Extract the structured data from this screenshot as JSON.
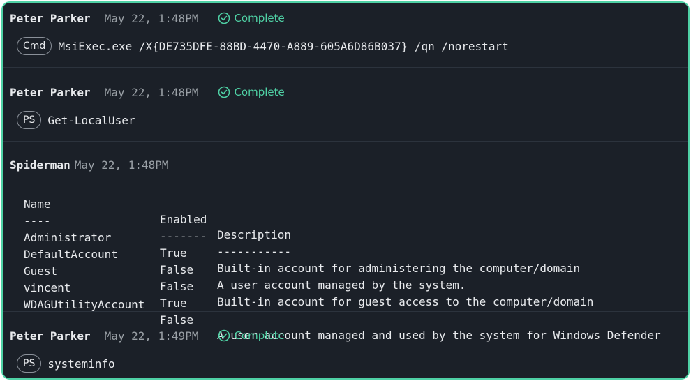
{
  "entries": [
    {
      "author": "Peter Parker",
      "time": "May 22, 1:48PM",
      "status": "Complete",
      "command_type": "Cmd",
      "command": "MsiExec.exe /X{DE735DFE-88BD-4470-A889-605A6D86B037} /qn /norestart"
    },
    {
      "author": "Peter Parker",
      "time": "May 22, 1:48PM",
      "status": "Complete",
      "command_type": "PS",
      "command": "Get-LocalUser"
    },
    {
      "author": "Spiderman",
      "time": "May 22, 1:48PM",
      "output": {
        "columns": [
          "Name",
          "Enabled",
          "Description"
        ],
        "underline": [
          "----",
          "-------",
          "-----------"
        ],
        "rows": [
          [
            "Administrator",
            "True",
            "Built-in account for administering the computer/domain"
          ],
          [
            "DefaultAccount",
            "False",
            "A user account managed by the system."
          ],
          [
            "Guest",
            "False",
            "Built-in account for guest access to the computer/domain"
          ],
          [
            "vincent",
            "True",
            ""
          ],
          [
            "WDAGUtilityAccount",
            "False",
            "A user account managed and used by the system for Windows Defender"
          ]
        ]
      }
    },
    {
      "author": "Peter Parker",
      "time": "May 22, 1:49PM",
      "status": "Complete",
      "command_type": "PS",
      "command": "systeminfo"
    }
  ],
  "colors": {
    "background": "#1b2028",
    "border_accent": "#4fd1a5",
    "status_complete": "#4fd1a5",
    "text": "#e8eaed",
    "muted": "#9aa0a6"
  },
  "icons": {
    "status": "check-circle-icon"
  }
}
